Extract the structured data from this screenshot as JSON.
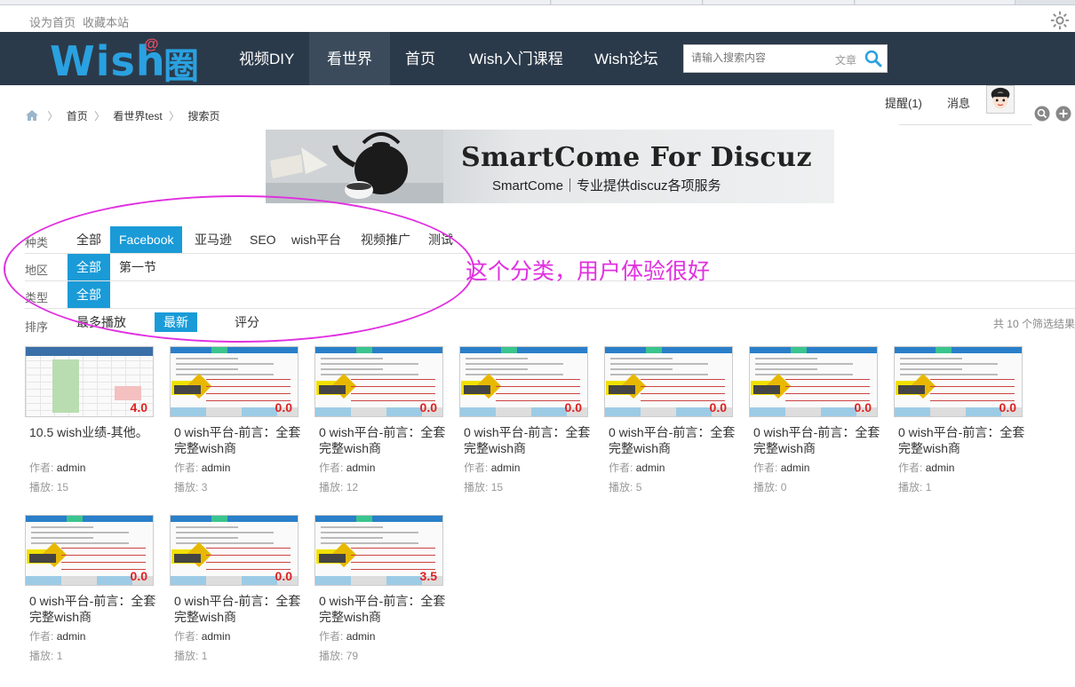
{
  "topbar": {
    "set_home": "设为首页",
    "bookmark": "收藏本站"
  },
  "nav": {
    "logo_text": "Wish",
    "logo_at": "@",
    "logo_quan": "圈",
    "items": [
      "视频DIY",
      "看世界",
      "首页",
      "Wish入门课程",
      "Wish论坛"
    ],
    "active_index": 1,
    "search_placeholder": "请输入搜索内容",
    "search_type": "文章"
  },
  "user": {
    "reminders": "提醒(1)",
    "messages": "消息"
  },
  "breadcrumb": [
    "首页",
    "看世界test",
    "搜索页"
  ],
  "banner": {
    "title": "SmartCome For Discuz",
    "subtitle": "SmartCome｜专业提供discuz各项服务"
  },
  "filters": {
    "category": {
      "label": "种类",
      "options": [
        "全部",
        "Facebook",
        "亚马逊",
        "SEO",
        "wish平台",
        "视频推广",
        "测试"
      ],
      "selected": "Facebook"
    },
    "region": {
      "label": "地区",
      "options": [
        "全部",
        "第一节"
      ],
      "selected": "全部"
    },
    "type": {
      "label": "类型",
      "options": [
        "全部"
      ],
      "selected": "全部"
    }
  },
  "sort": {
    "label": "排序",
    "options": [
      "最多播放",
      "最新",
      "评分"
    ],
    "selected": "最新",
    "result_count": "共 10 个筛选结果"
  },
  "annotation": "这个分类，用户体验很好",
  "author_label": "作者:",
  "plays_label": "播放:",
  "videos": [
    {
      "title": "10.5 wish业绩-其他。",
      "author": "admin",
      "plays": "15",
      "score": "4.0",
      "thumb": "table"
    },
    {
      "title": "0 wish平台-前言：全套完整wish商",
      "author": "admin",
      "plays": "3",
      "score": "0.0",
      "thumb": "page"
    },
    {
      "title": "0 wish平台-前言：全套完整wish商",
      "author": "admin",
      "plays": "12",
      "score": "0.0",
      "thumb": "page"
    },
    {
      "title": "0 wish平台-前言：全套完整wish商",
      "author": "admin",
      "plays": "15",
      "score": "0.0",
      "thumb": "page"
    },
    {
      "title": "0 wish平台-前言：全套完整wish商",
      "author": "admin",
      "plays": "5",
      "score": "0.0",
      "thumb": "page"
    },
    {
      "title": "0 wish平台-前言：全套完整wish商",
      "author": "admin",
      "plays": "0",
      "score": "0.0",
      "thumb": "page"
    },
    {
      "title": "0 wish平台-前言：全套完整wish商",
      "author": "admin",
      "plays": "1",
      "score": "0.0",
      "thumb": "page"
    },
    {
      "title": "0 wish平台-前言：全套完整wish商",
      "author": "admin",
      "plays": "1",
      "score": "0.0",
      "thumb": "page"
    },
    {
      "title": "0 wish平台-前言：全套完整wish商",
      "author": "admin",
      "plays": "1",
      "score": "0.0",
      "thumb": "page"
    },
    {
      "title": "0 wish平台-前言：全套完整wish商",
      "author": "admin",
      "plays": "79",
      "score": "3.5",
      "thumb": "page"
    }
  ],
  "colors": {
    "nav_bg": "#2b3a4a",
    "accent": "#1a9bd7",
    "logo": "#2aa1e0",
    "annotation": "#e030e0",
    "score": "#e02020"
  }
}
